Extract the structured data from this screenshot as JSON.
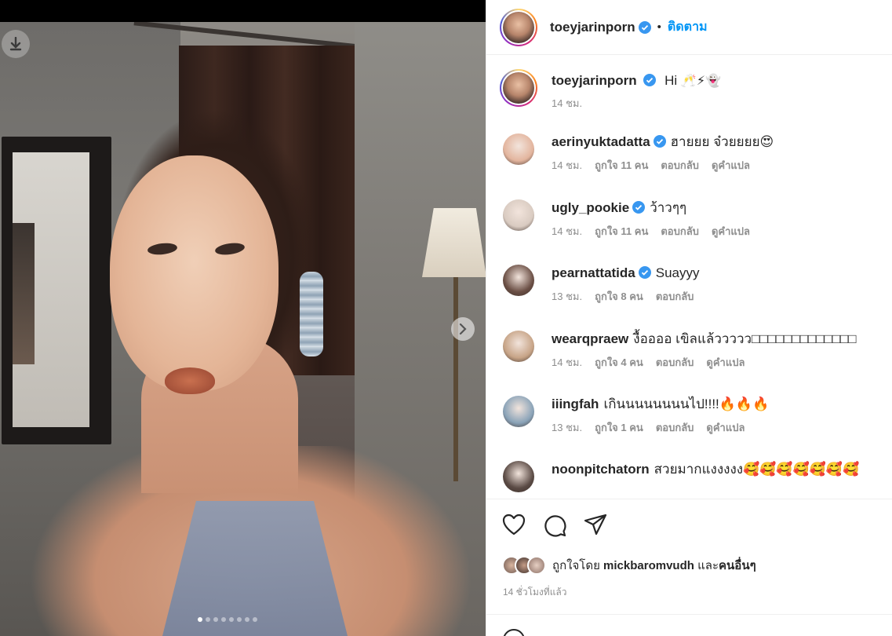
{
  "post": {
    "author": "toeyjarinporn",
    "follow_label": "ติดตาม",
    "separator": "•",
    "caption_text": "Hi",
    "caption_emojis": "🥂⚡👻",
    "caption_time": "14 ชม.",
    "carousel": {
      "total": 8,
      "active_index": 0
    }
  },
  "comments": [
    {
      "user": "aerinyuktadatta",
      "verified": true,
      "text": "ฮายยย จ๋วยยยย😍",
      "time": "14 ชม.",
      "likes": "ถูกใจ 11 คน",
      "reply": "ตอบกลับ",
      "translate": "ดูคำแปล",
      "avatar_color": "#e3b59e"
    },
    {
      "user": "ugly_pookie",
      "verified": true,
      "text": "ว้าวๆๆ",
      "time": "14 ชม.",
      "likes": "ถูกใจ 11 คน",
      "reply": "ตอบกลับ",
      "translate": "ดูคำแปล",
      "avatar_color": "#d9cbc1"
    },
    {
      "user": "pearnattatida",
      "verified": true,
      "text": "Suayyy",
      "time": "13 ชม.",
      "likes": "ถูกใจ 8 คน",
      "reply": "ตอบกลับ",
      "translate": "",
      "avatar_color": "#6b4f45"
    },
    {
      "user": "wearqpraew",
      "verified": false,
      "text": "งื้ออออ เขิลแล้ววววว□□□□□□□□□□□□□",
      "time": "14 ชม.",
      "likes": "ถูกใจ 4 คน",
      "reply": "ตอบกลับ",
      "translate": "ดูคำแปล",
      "avatar_color": "#c7a487"
    },
    {
      "user": "iiingfah",
      "verified": false,
      "text": "เกินนนนนนนนไป!!!!🔥🔥🔥",
      "time": "13 ชม.",
      "likes": "ถูกใจ 1 คน",
      "reply": "ตอบกลับ",
      "translate": "ดูคำแปล",
      "avatar_color": "#8aa3b8"
    },
    {
      "user": "noonpitchatorn",
      "verified": false,
      "text": "สวยมากแงงงงง🥰🥰🥰🥰🥰🥰🥰",
      "time": "",
      "likes": "",
      "reply": "",
      "translate": "",
      "avatar_color": "#5a4a44"
    }
  ],
  "actions": {
    "likes_prefix": "ถูกใจโดย",
    "likes_user": "mickbaromvudh",
    "likes_and": "และ",
    "likes_others": "คนอื่นๆ",
    "timestamp": "14 ชั่วโมงที่แล้ว"
  },
  "colors": {
    "accent": "#0095f6",
    "verified": "#3897f0",
    "muted": "#8e8e8e"
  },
  "icons": [
    "download-icon",
    "chevron-right-icon",
    "verified-icon",
    "heart-icon",
    "comment-icon",
    "share-icon",
    "emoji-icon"
  ]
}
